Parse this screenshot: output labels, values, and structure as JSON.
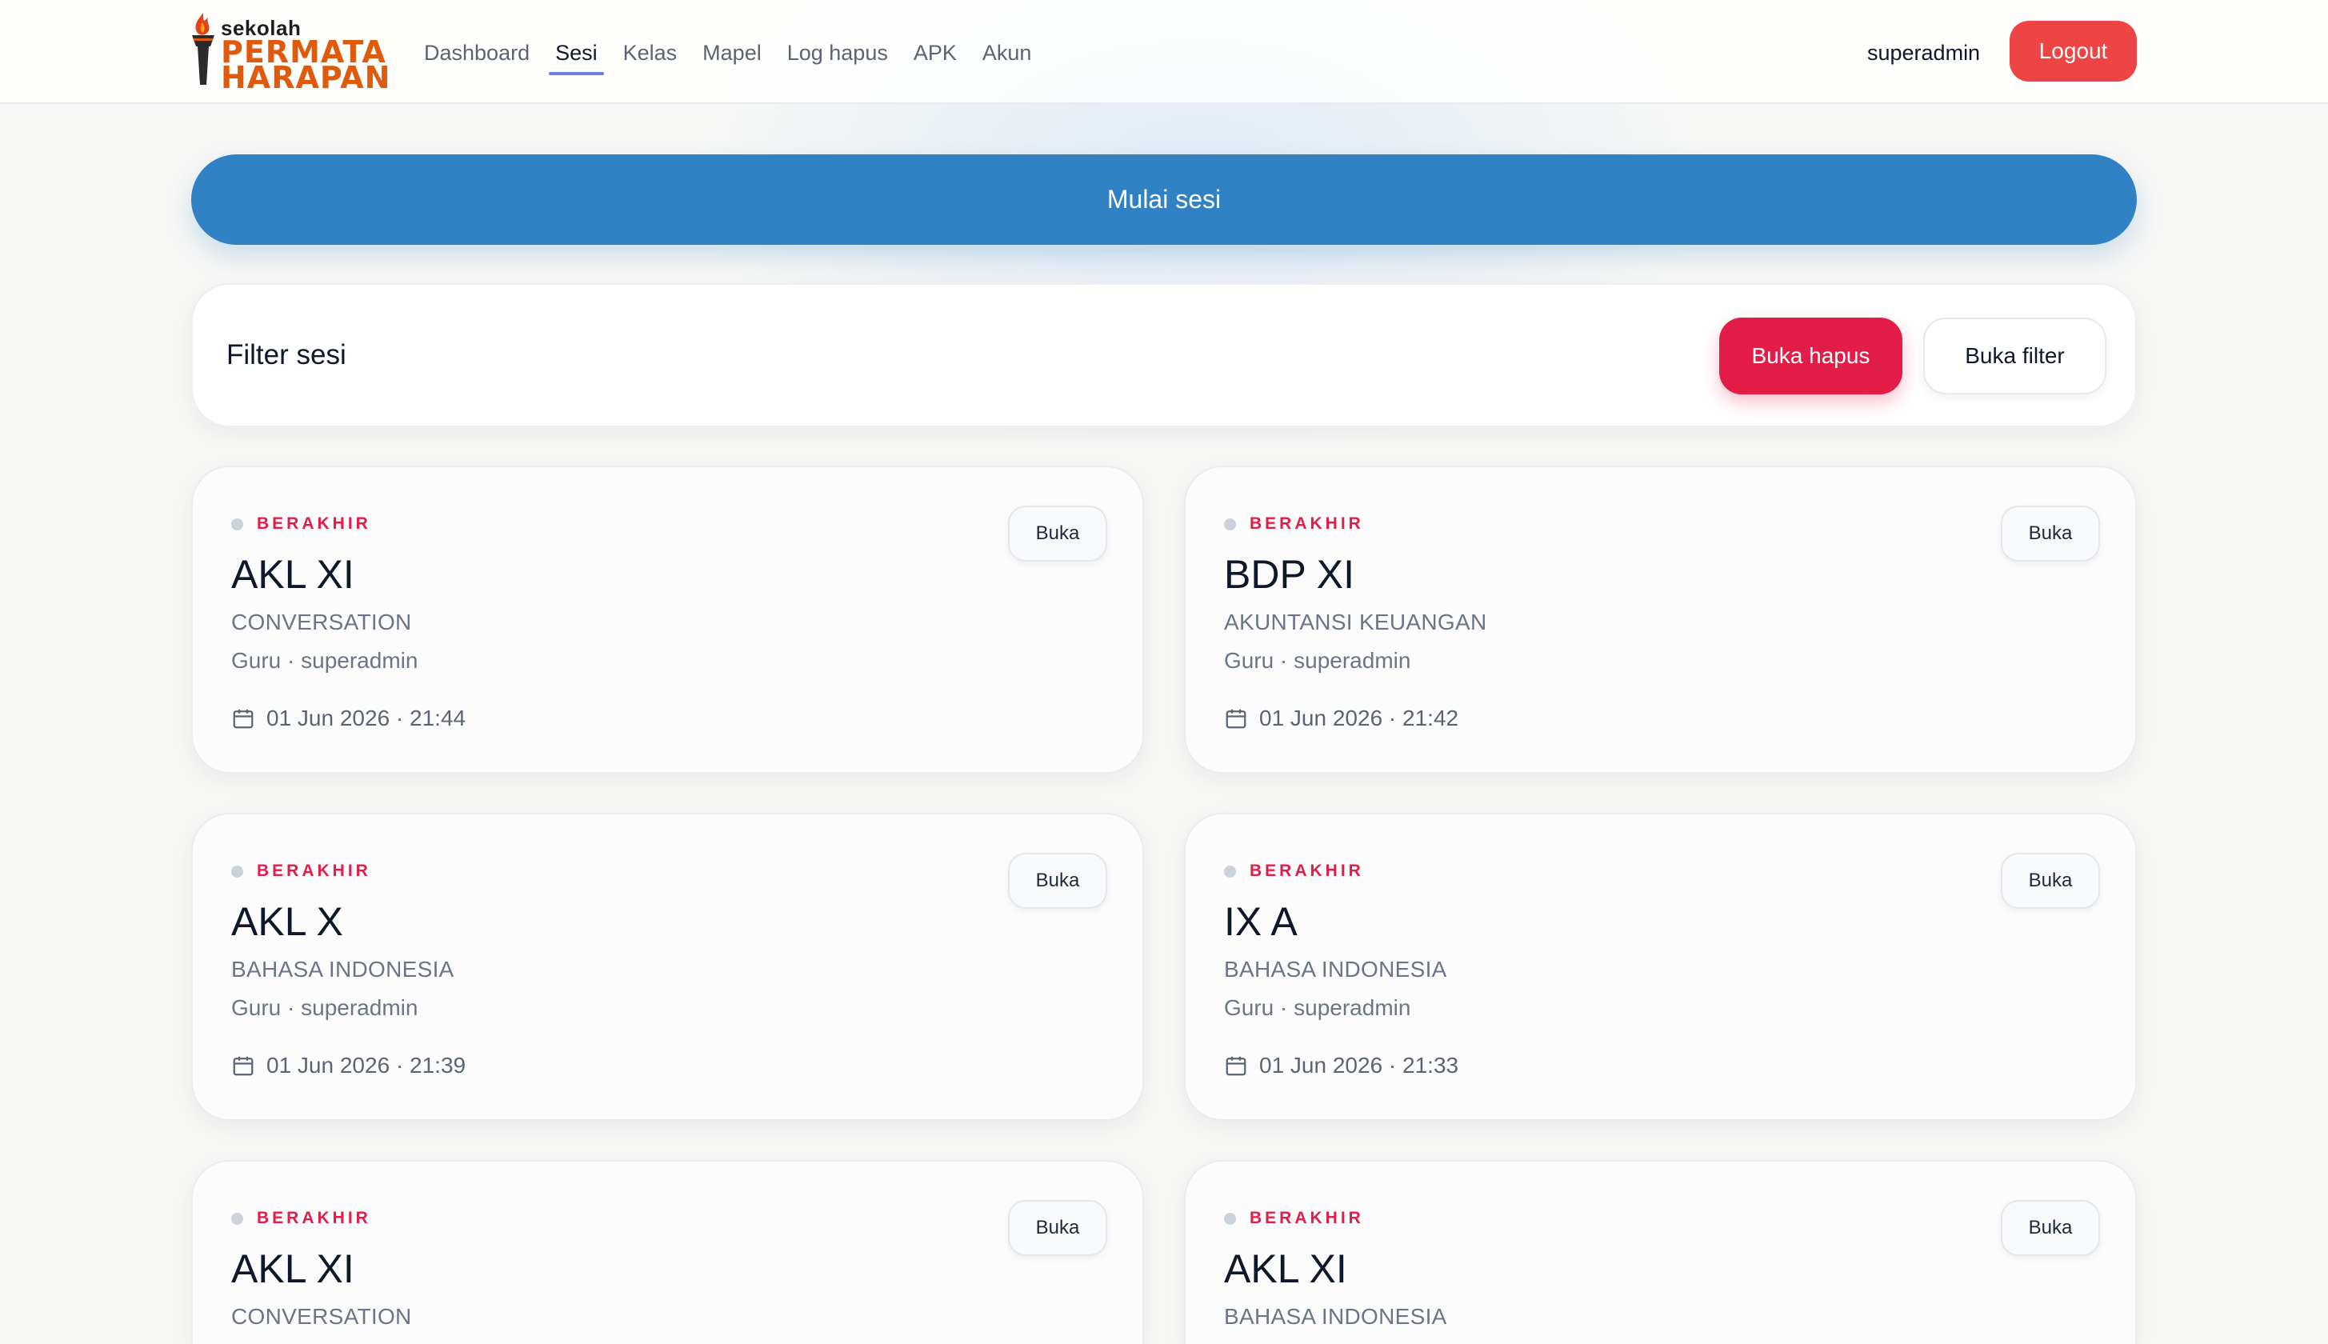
{
  "header": {
    "logo": {
      "small_text": "sekolah",
      "line1": "PERMATA",
      "line2": "HARAPAN"
    },
    "nav": [
      {
        "label": "Dashboard",
        "active": false
      },
      {
        "label": "Sesi",
        "active": true
      },
      {
        "label": "Kelas",
        "active": false
      },
      {
        "label": "Mapel",
        "active": false
      },
      {
        "label": "Log hapus",
        "active": false
      },
      {
        "label": "APK",
        "active": false
      },
      {
        "label": "Akun",
        "active": false
      }
    ],
    "username": "superadmin",
    "logout_label": "Logout"
  },
  "start_session_label": "Mulai sesi",
  "filter": {
    "title": "Filter sesi",
    "delete_label": "Buka hapus",
    "filter_label": "Buka filter"
  },
  "sessions": [
    {
      "status": "BERAKHIR",
      "title": "AKL XI",
      "subject": "CONVERSATION",
      "teacher": "Guru · superadmin",
      "datetime": "01 Jun 2026 · 21:44",
      "open_label": "Buka"
    },
    {
      "status": "BERAKHIR",
      "title": "BDP XI",
      "subject": "AKUNTANSI KEUANGAN",
      "teacher": "Guru · superadmin",
      "datetime": "01 Jun 2026 · 21:42",
      "open_label": "Buka"
    },
    {
      "status": "BERAKHIR",
      "title": "AKL X",
      "subject": "BAHASA INDONESIA",
      "teacher": "Guru · superadmin",
      "datetime": "01 Jun 2026 · 21:39",
      "open_label": "Buka"
    },
    {
      "status": "BERAKHIR",
      "title": "IX A",
      "subject": "BAHASA INDONESIA",
      "teacher": "Guru · superadmin",
      "datetime": "01 Jun 2026 · 21:33",
      "open_label": "Buka"
    },
    {
      "status": "BERAKHIR",
      "title": "AKL XI",
      "subject": "CONVERSATION",
      "teacher": "",
      "datetime": "",
      "open_label": "Buka"
    },
    {
      "status": "BERAKHIR",
      "title": "AKL XI",
      "subject": "BAHASA INDONESIA",
      "teacher": "",
      "datetime": "",
      "open_label": "Buka"
    }
  ],
  "colors": {
    "primary_blue": "#3182c4",
    "danger_red": "#ef4444",
    "delete_red": "#e11d48",
    "status_red": "#e11d48",
    "nav_active_underline": "#6d7ee8",
    "logo_orange": "#e05a0c"
  },
  "icons": {
    "calendar": "calendar-icon",
    "logo_torch": "torch-icon",
    "status_dot": "status-dot"
  }
}
